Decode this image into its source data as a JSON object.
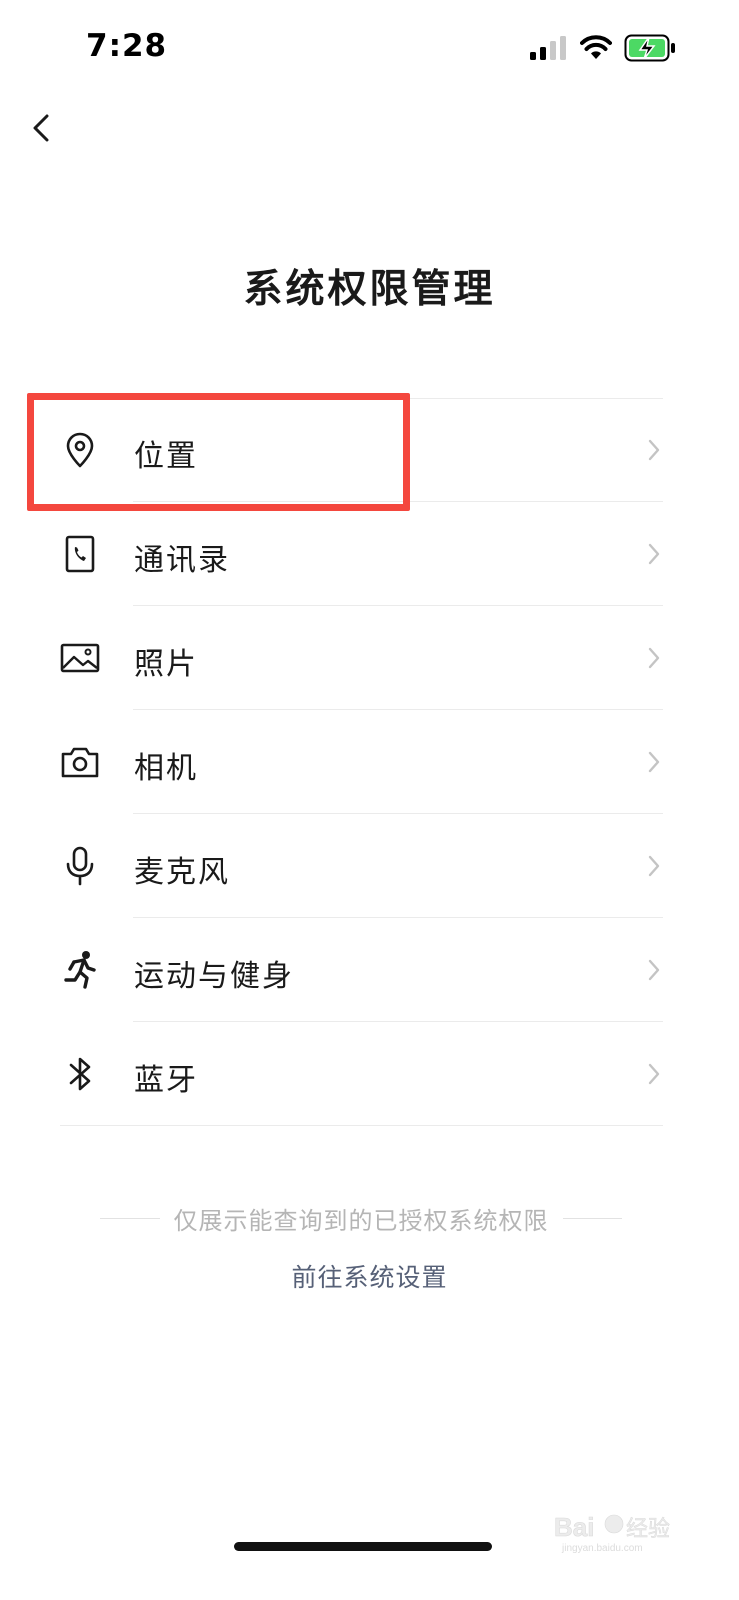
{
  "status_bar": {
    "time": "7:28",
    "icons": [
      "cellular-signal-icon",
      "wifi-icon",
      "battery-charging-icon"
    ],
    "battery_color": "#4cd964"
  },
  "nav": {
    "back_icon": "chevron-left-icon"
  },
  "title": "系统权限管理",
  "permissions": [
    {
      "label": "位置",
      "icon": "location-pin-icon"
    },
    {
      "label": "通讯录",
      "icon": "contacts-phone-icon"
    },
    {
      "label": "照片",
      "icon": "photo-icon"
    },
    {
      "label": "相机",
      "icon": "camera-icon"
    },
    {
      "label": "麦克风",
      "icon": "microphone-icon"
    },
    {
      "label": "运动与健身",
      "icon": "running-icon"
    },
    {
      "label": "蓝牙",
      "icon": "bluetooth-icon"
    }
  ],
  "highlighted_item": "位置",
  "footer": {
    "note": "仅展示能查询到的已授权系统权限",
    "link": "前往系统设置"
  },
  "watermark": {
    "text": "Bai经验",
    "sub": "jingyan.baidu.com"
  },
  "colors": {
    "highlight": "#f4473e",
    "link": "#566077",
    "note": "#b5b5b5"
  }
}
